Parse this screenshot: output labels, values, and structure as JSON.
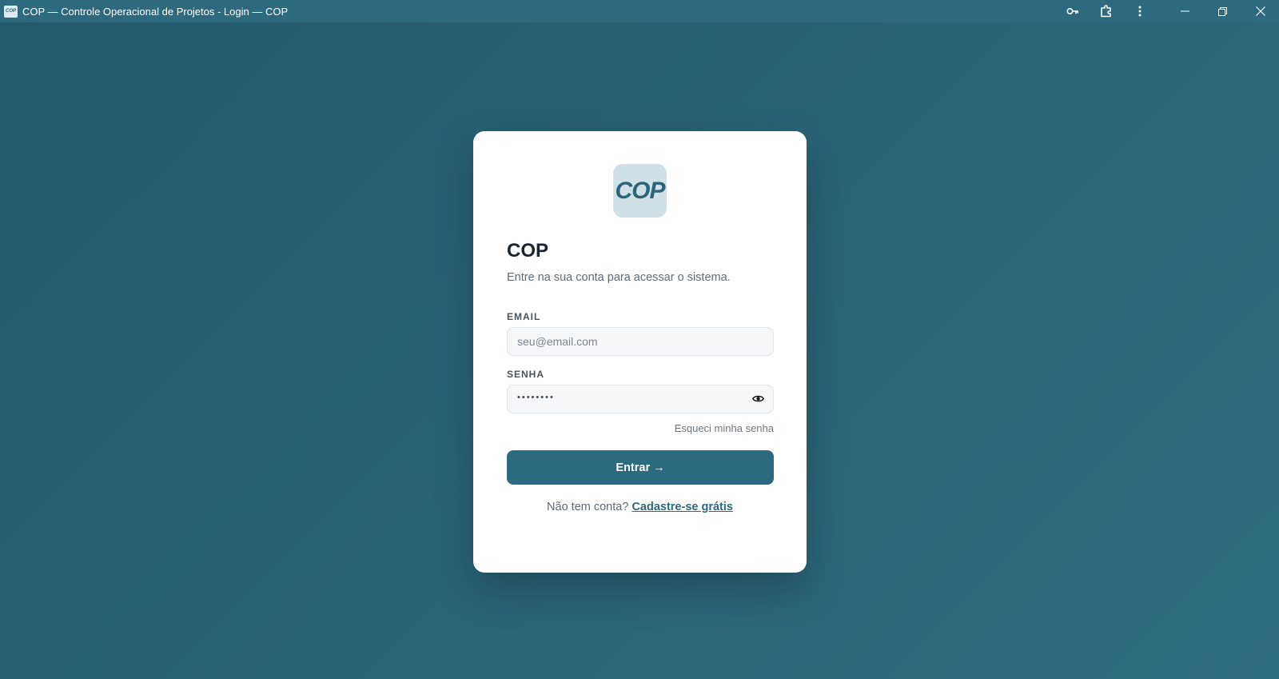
{
  "window": {
    "title": "COP — Controle Operacional de Projetos - Login — COP",
    "app_icon_text": "COP",
    "controls": [
      "key-icon",
      "extensions-icon",
      "more-vert-icon",
      "minimize-icon",
      "restore-icon",
      "close-icon"
    ]
  },
  "card": {
    "logo_text": "COP",
    "heading": "COP",
    "subtitle": "Entre na sua conta para acessar o sistema.",
    "email": {
      "label": "EMAIL",
      "placeholder": "seu@email.com",
      "value": ""
    },
    "password": {
      "label": "SENHA",
      "masked_value": "••••••••",
      "toggle_icon": "eye-icon"
    },
    "forgot_link": "Esqueci minha senha",
    "submit_label": "Entrar →",
    "signup_prompt": "Não tem conta?",
    "signup_link": "Cadastre-se grátis"
  },
  "colors": {
    "background": "#2a6478",
    "titlebar": "#2d6a80",
    "primary": "#2c6a7f",
    "logo_bg": "#cfe1e7",
    "card": "#ffffff"
  }
}
